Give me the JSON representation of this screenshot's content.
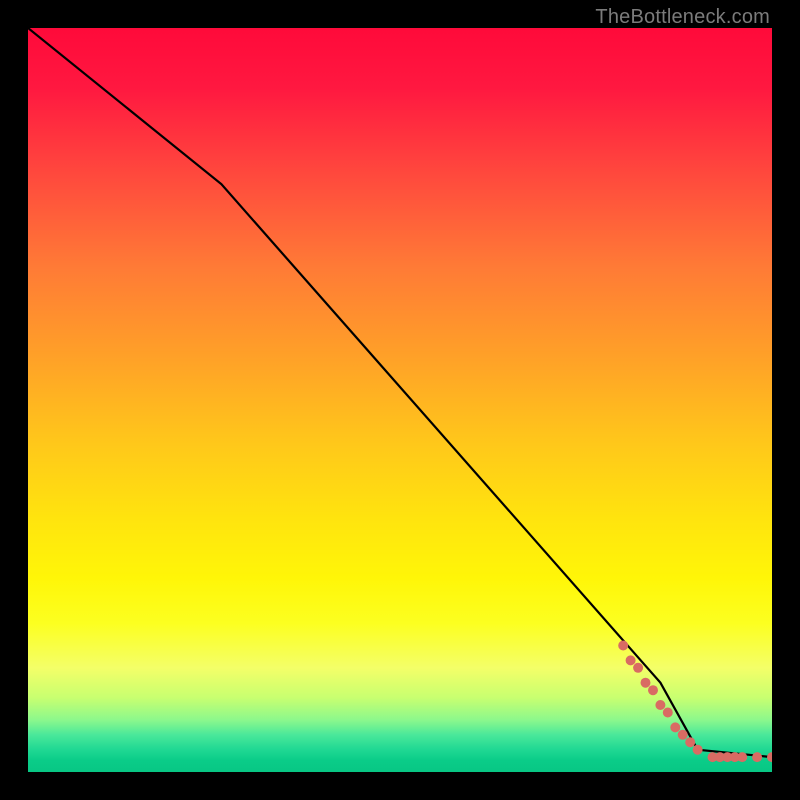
{
  "attribution": "TheBottleneck.com",
  "chart_data": {
    "type": "line",
    "title": "",
    "xlabel": "",
    "ylabel": "",
    "xlim": [
      0,
      100
    ],
    "ylim": [
      0,
      100
    ],
    "series": [
      {
        "name": "bottleneck-curve",
        "style": "solid-black",
        "points": [
          {
            "x": 0,
            "y": 100
          },
          {
            "x": 26,
            "y": 79
          },
          {
            "x": 85,
            "y": 12
          },
          {
            "x": 90,
            "y": 3
          },
          {
            "x": 100,
            "y": 2
          }
        ]
      },
      {
        "name": "data-dots",
        "style": "coral-dots",
        "points": [
          {
            "x": 80,
            "y": 17
          },
          {
            "x": 81,
            "y": 15
          },
          {
            "x": 82,
            "y": 14
          },
          {
            "x": 83,
            "y": 12
          },
          {
            "x": 84,
            "y": 11
          },
          {
            "x": 85,
            "y": 9
          },
          {
            "x": 86,
            "y": 8
          },
          {
            "x": 87,
            "y": 6
          },
          {
            "x": 88,
            "y": 5
          },
          {
            "x": 89,
            "y": 4
          },
          {
            "x": 90,
            "y": 3
          },
          {
            "x": 92,
            "y": 2
          },
          {
            "x": 93,
            "y": 2
          },
          {
            "x": 94,
            "y": 2
          },
          {
            "x": 95,
            "y": 2
          },
          {
            "x": 96,
            "y": 2
          },
          {
            "x": 98,
            "y": 2
          },
          {
            "x": 100,
            "y": 2
          }
        ]
      }
    ],
    "colors": {
      "curve": "#000000",
      "dots": "#d96b63",
      "gradient_top": "#ff0a3a",
      "gradient_mid": "#ffe40e",
      "gradient_bottom": "#08c784"
    }
  }
}
